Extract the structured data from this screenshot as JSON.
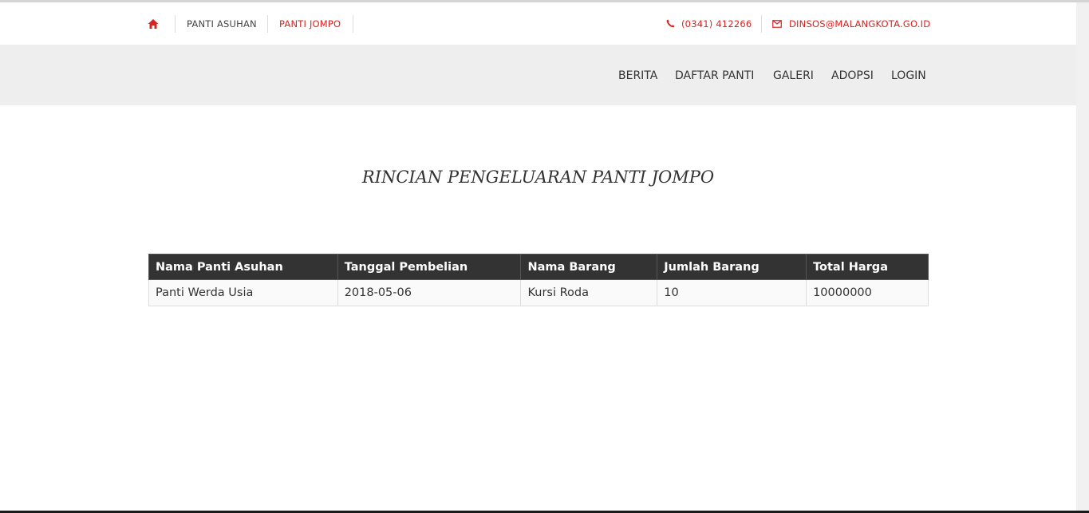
{
  "topbar": {
    "links": [
      "PANTI ASUHAN",
      "PANTI JOMPO"
    ],
    "phone": "(0341) 412266",
    "email": "DINSOS@MALANGKOTA.GO.ID"
  },
  "nav": {
    "items": [
      "BERITA",
      "DAFTAR PANTI",
      "GALERI",
      "ADOPSI",
      "LOGIN"
    ]
  },
  "page_title": "RINCIAN PENGELUARAN PANTI JOMPO",
  "table": {
    "headers": [
      "Nama Panti Asuhan",
      "Tanggal Pembelian",
      "Nama Barang",
      "Jumlah Barang",
      "Total Harga"
    ],
    "rows": [
      [
        "Panti Werda Usia",
        "2018-05-06",
        "Kursi Roda",
        "10",
        "10000000"
      ]
    ]
  },
  "colors": {
    "accent": "#d9231f",
    "header_bg": "#333333",
    "nav_bg": "#eeeeee"
  },
  "icons": [
    "home-icon",
    "phone-icon",
    "mail-icon"
  ]
}
